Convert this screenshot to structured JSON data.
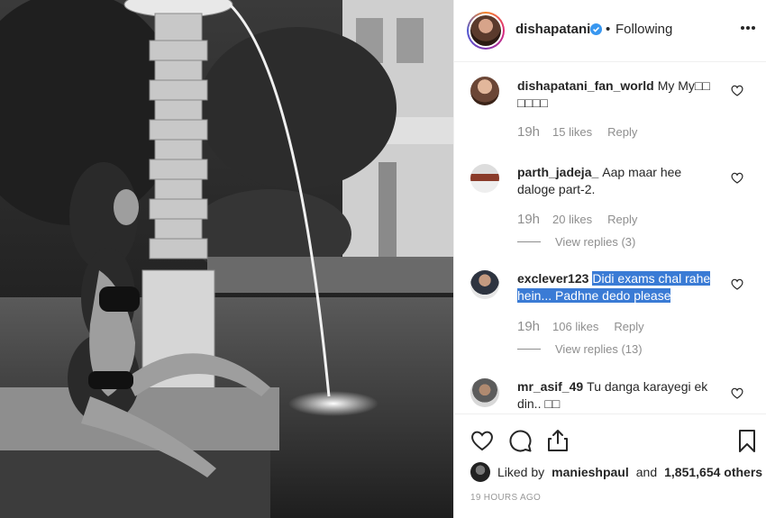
{
  "post": {
    "username": "dishapatani",
    "dot": "•",
    "follow_status": "Following",
    "liked_by_prefix": "Liked by",
    "liked_by_user": "manieshpaul",
    "liked_by_and": "and",
    "liked_by_others": "1,851,654 others",
    "time_ago": "19 HOURS AGO"
  },
  "comments": [
    {
      "user": "dishapatani_fan_world",
      "text": "My My□□ □□□□",
      "time": "19h",
      "likes": "15 likes",
      "reply": "Reply"
    },
    {
      "user": "parth_jadeja_",
      "text": "Aap maar hee daloge part-2.",
      "time": "19h",
      "likes": "20 likes",
      "reply": "Reply",
      "view_replies": "View replies (3)"
    },
    {
      "user": "exclever123",
      "text_line1": "Didi exams chal rahe",
      "text_line2": "hein... Padhne dedo please",
      "time": "19h",
      "likes": "106 likes",
      "reply": "Reply",
      "view_replies": "View replies (13)"
    },
    {
      "user": "mr_asif_49",
      "text": "Tu danga karayegi ek din.. □□"
    }
  ],
  "icons": {
    "verified": "verified-badge-icon",
    "more": "more-options-icon",
    "heart": "heart-icon",
    "comment": "comment-icon",
    "share": "share-icon",
    "save": "bookmark-icon"
  },
  "colors": {
    "verified": "#3897f0",
    "highlight": "#3a7bd5",
    "muted": "#8e8e8e"
  }
}
